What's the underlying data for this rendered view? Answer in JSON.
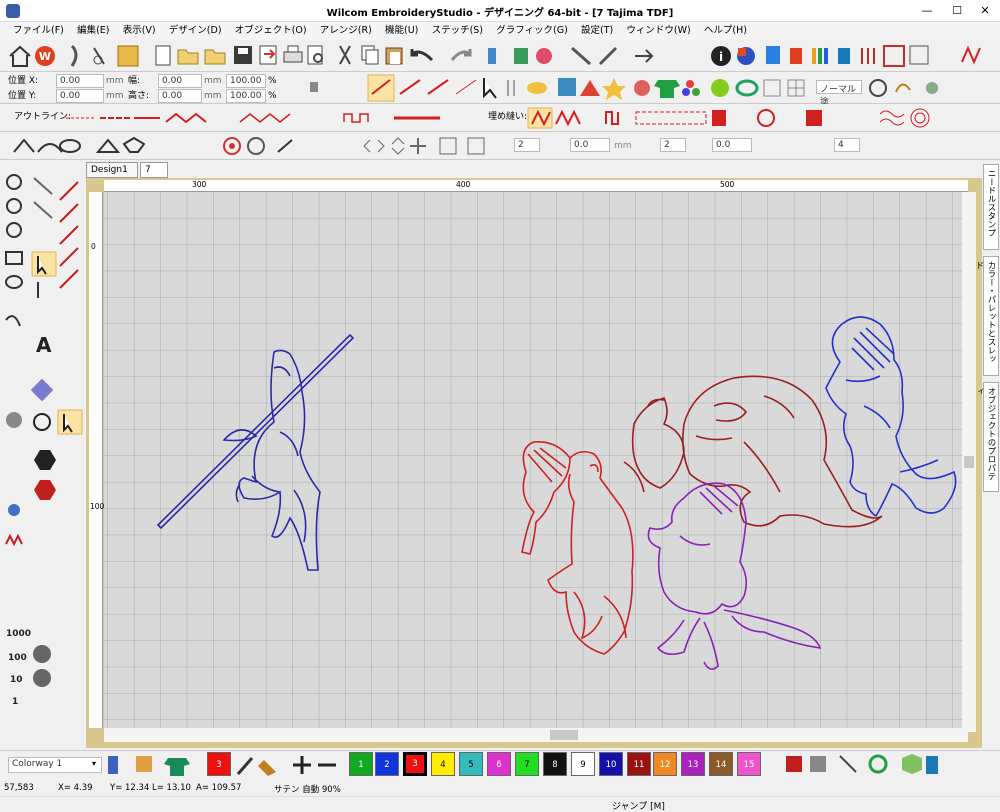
{
  "window": {
    "title": "Wilcom EmbroideryStudio - デザイニング 64-bit - [7            Tajima TDF]",
    "minimize": "—",
    "maximize": "☐",
    "close": "✕"
  },
  "menu": [
    "ファイル(F)",
    "編集(E)",
    "表示(V)",
    "デザイン(D)",
    "オブジェクト(O)",
    "アレンジ(R)",
    "機能(U)",
    "ステッチ(S)",
    "グラフィック(G)",
    "設定(T)",
    "ウィンドウ(W)",
    "ヘルプ(H)"
  ],
  "position": {
    "x_label": "位置 X:",
    "y_label": "位置 Y:",
    "x_value": "0.00",
    "y_value": "0.00",
    "unit": "mm",
    "width_label": "幅:",
    "height_label": "高さ:",
    "width_value": "0.00",
    "height_value": "0.00",
    "scale_w": "100.00",
    "scale_h": "100.00",
    "pct": "%"
  },
  "outline_label": "アウトライン:",
  "fill_label": "埋め縫い:",
  "fill_dropdown": "ノーマル塗",
  "toolbar4": {
    "val1": "2",
    "val2": "0.0",
    "unit": "mm",
    "val3": "2",
    "val4": "0.0",
    "val5": "4"
  },
  "tabs": [
    {
      "label": "Design1",
      "close": "✕"
    },
    {
      "label": "7",
      "close": "✕"
    }
  ],
  "ruler": {
    "h_ticks": [
      "300",
      "400",
      "500"
    ],
    "v_ticks": [
      "0",
      "100"
    ]
  },
  "right_panels": [
    "ニードルスタンプ",
    "カラー・パレットとスレッド",
    "オブジェクトのプロパティ"
  ],
  "colorway": "Colorway 1",
  "swatches": [
    {
      "label": "3",
      "color": "#ee1111"
    },
    {
      "label": "1",
      "color": "#11aa22"
    },
    {
      "label": "2",
      "color": "#1133dd"
    },
    {
      "label": "3",
      "color": "#ee1111"
    },
    {
      "label": "4",
      "color": "#ffee00"
    },
    {
      "label": "5",
      "color": "#33bbbb"
    },
    {
      "label": "6",
      "color": "#dd33cc"
    },
    {
      "label": "7",
      "color": "#22dd22"
    },
    {
      "label": "8",
      "color": "#111111"
    },
    {
      "label": "9",
      "color": "#ffffff"
    },
    {
      "label": "10",
      "color": "#1111aa"
    },
    {
      "label": "11",
      "color": "#991111"
    },
    {
      "label": "12",
      "color": "#ee8822"
    },
    {
      "label": "13",
      "color": "#aa22bb"
    },
    {
      "label": "14",
      "color": "#8b5a2b"
    },
    {
      "label": "15",
      "color": "#ee55cc"
    }
  ],
  "status": {
    "coords": "57,583",
    "x": "X=   4.39",
    "y": "Y= 12.34",
    "l": "L=  13.10",
    "a": "A= 109.57",
    "mode": "サテン 自動 90%"
  },
  "status2": "ジャンプ [M]",
  "design_colors": {
    "figure1": "#2a2aa8",
    "red": "#cc2222",
    "darkred": "#9a2020",
    "purple": "#8a22b8",
    "blue": "#2233cc"
  }
}
